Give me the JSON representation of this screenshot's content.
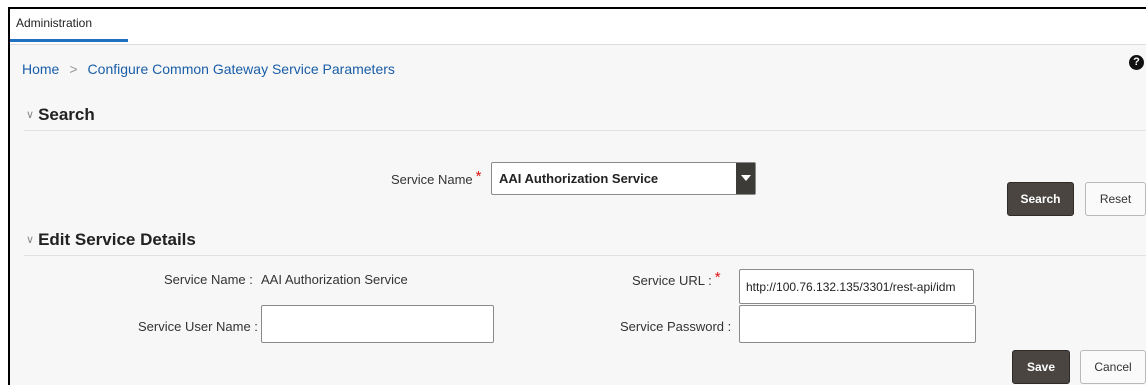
{
  "tabs": [
    {
      "label": "Administration"
    }
  ],
  "breadcrumb": {
    "home": "Home",
    "separator": ">",
    "current": "Configure Common Gateway Service Parameters"
  },
  "help_icon": "help-icon",
  "search": {
    "title": "Search",
    "service_name_label": "Service Name",
    "service_name_value": "AAI Authorization Service",
    "search_button": "Search",
    "reset_button": "Reset"
  },
  "edit": {
    "title": "Edit Service Details",
    "service_name_label": "Service Name :",
    "service_name_value": "AAI Authorization Service",
    "service_url_label": "Service URL :",
    "service_url_value": "http://100.76.132.135/3301/rest-api/idm",
    "service_user_label": "Service User Name :",
    "service_user_value": "",
    "service_password_label": "Service Password :",
    "service_password_value": "",
    "save_button": "Save",
    "cancel_button": "Cancel"
  },
  "colors": {
    "accent": "#1f70c1",
    "link": "#1a5ea8",
    "dark_button": "#4a4541",
    "required": "#dd1111"
  }
}
